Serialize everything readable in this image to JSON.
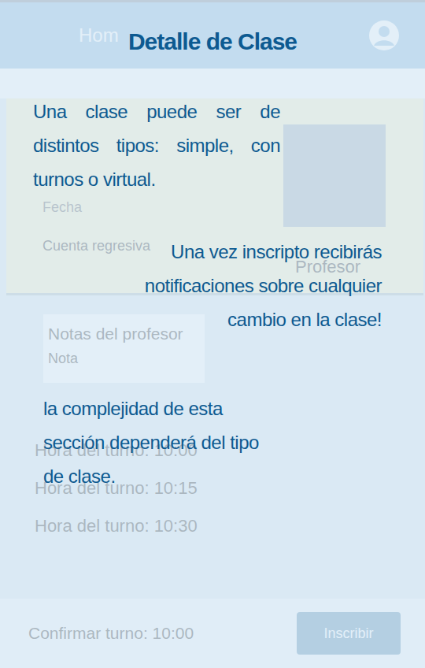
{
  "app": {
    "header": {
      "title": "Hom"
    },
    "class_card": {
      "date_label": "Fecha",
      "countdown_label": "Cuenta regresiva",
      "teacher_label": "Profesor"
    },
    "notes": {
      "title": "Notas del profesor",
      "text": "Nota"
    },
    "slots": [
      {
        "label": "Hora del turno: 10:00"
      },
      {
        "label": "Hora del turno: 10:15"
      },
      {
        "label": "Hora del turno: 10:30"
      }
    ],
    "footer": {
      "confirm": "Confirmar turno: 10:00",
      "button": "Inscribir"
    }
  },
  "tutorial": {
    "title": "Detalle de Clase",
    "tips": [
      "Una clase puede ser de distintos tipos: simple, con turnos o virtual.",
      "Una vez inscripto recibirás notificaciones sobre cualquier cambio en la clase!",
      "la complejidad de esta sección dependerá del tipo de clase."
    ]
  }
}
